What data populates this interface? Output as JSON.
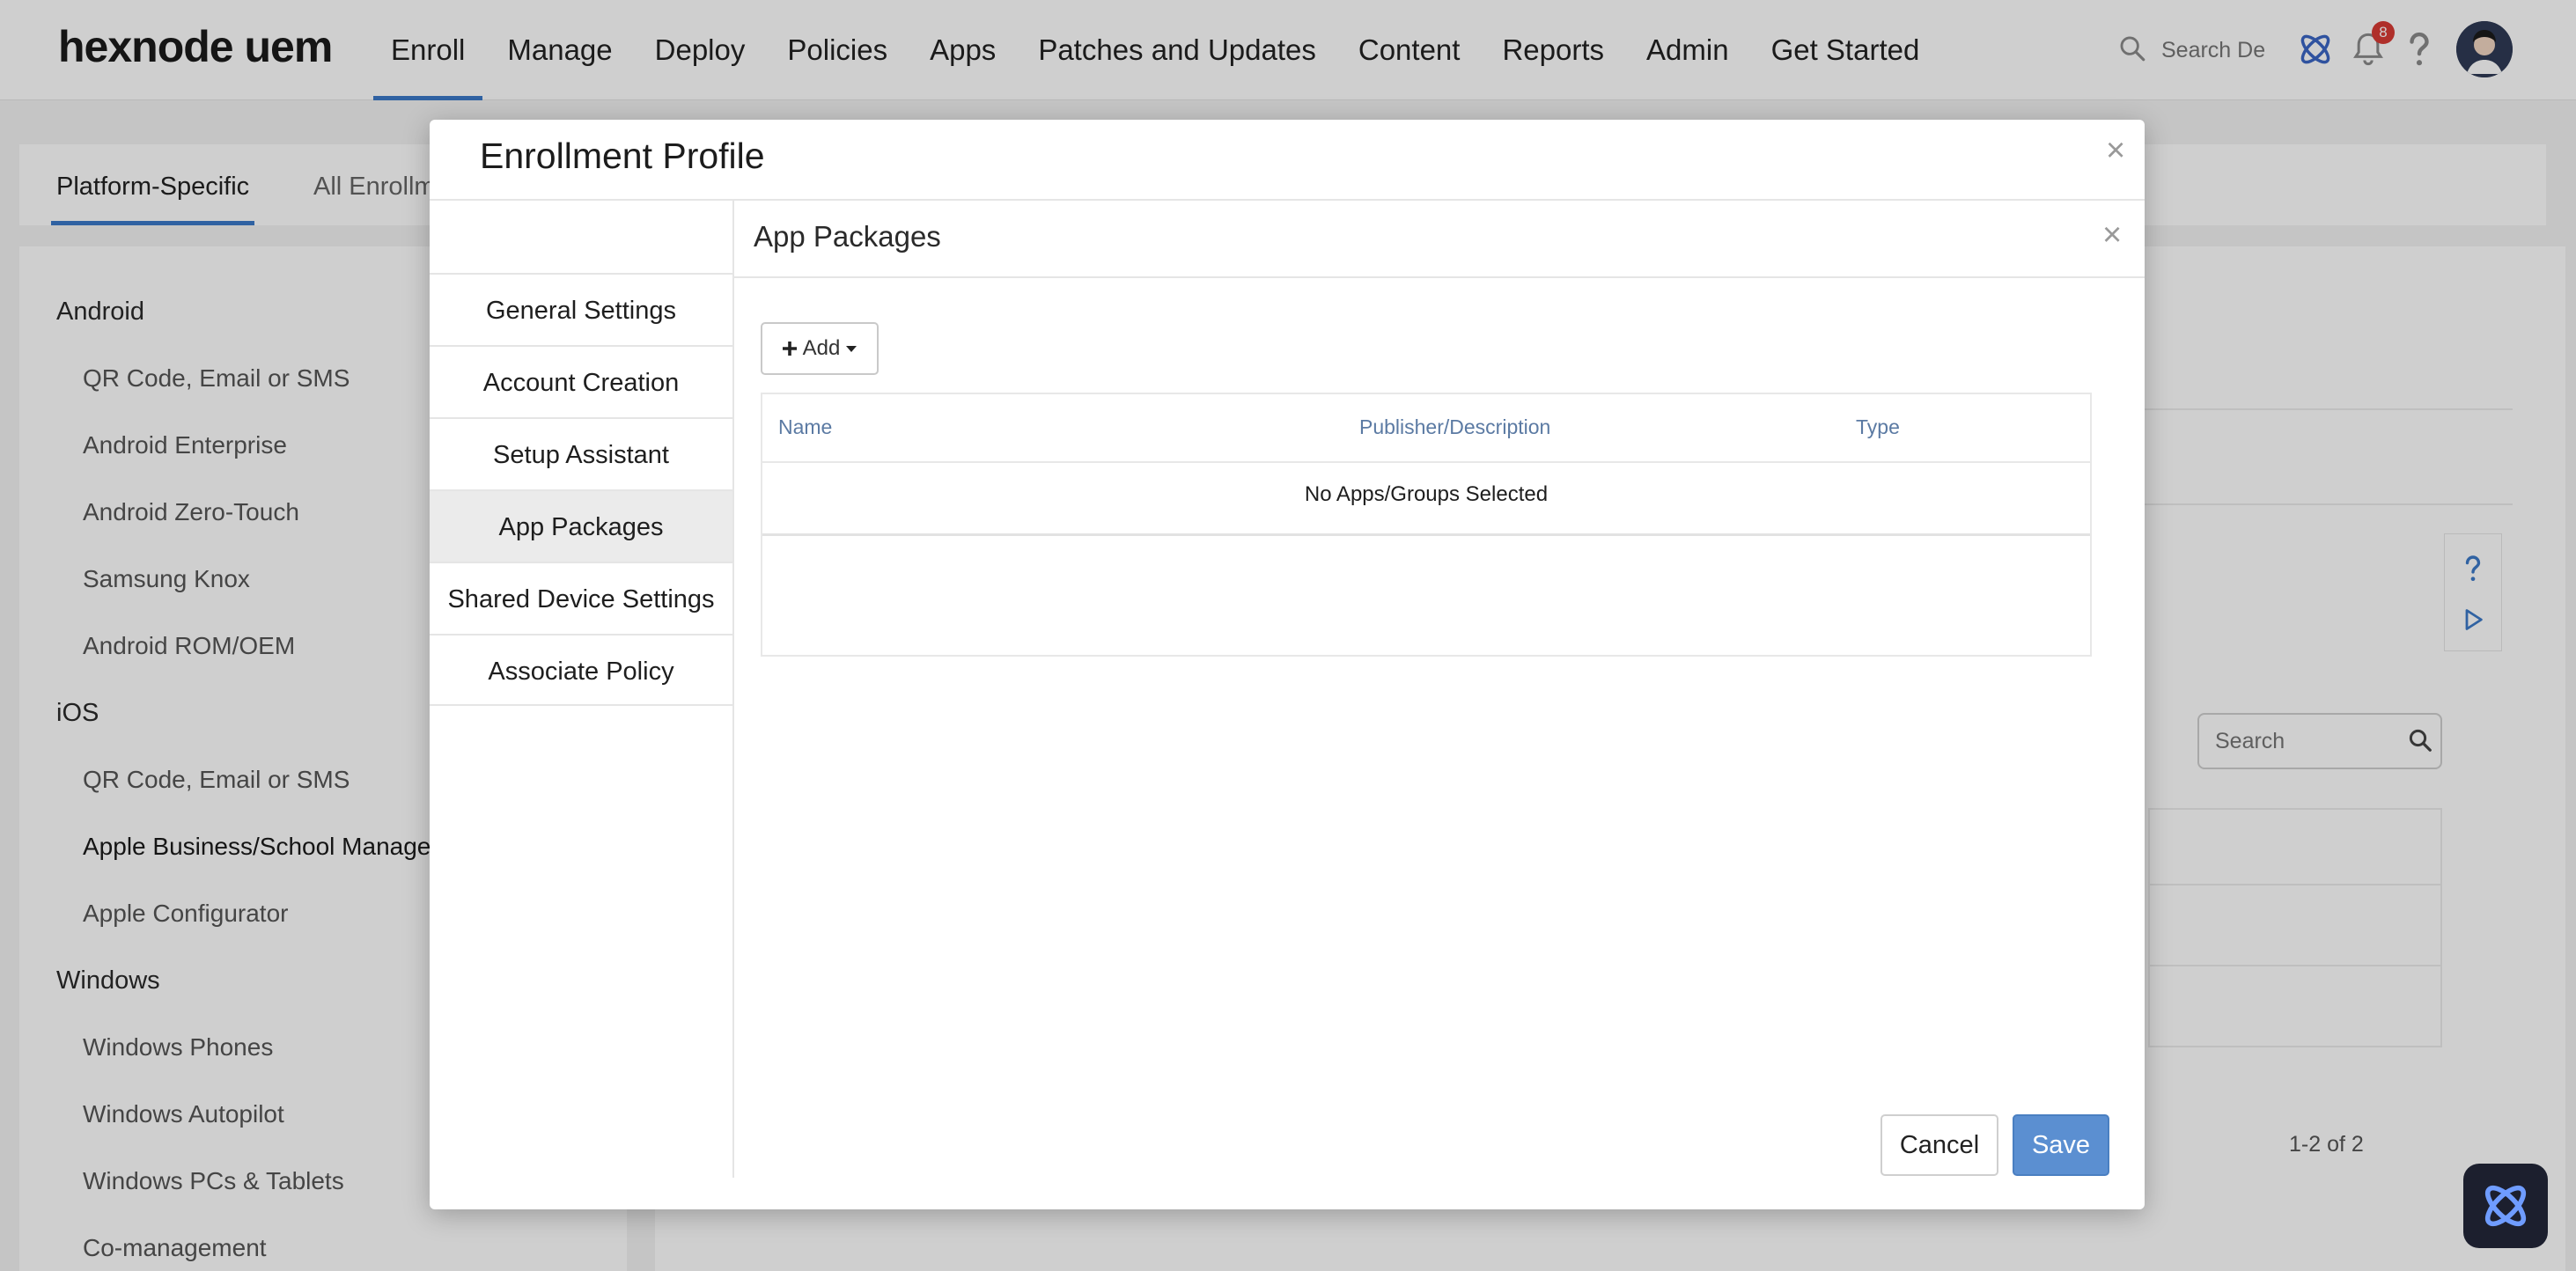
{
  "app": {
    "logo": "hexnode uem"
  },
  "nav": {
    "items": [
      "Enroll",
      "Manage",
      "Deploy",
      "Policies",
      "Apps",
      "Patches and Updates",
      "Content",
      "Reports",
      "Admin",
      "Get Started"
    ],
    "active": "Enroll"
  },
  "header": {
    "search_placeholder": "Search De",
    "notification_count": "8",
    "icons": [
      "search-icon",
      "hexnode-assist-icon",
      "bell-icon",
      "help-icon",
      "avatar"
    ]
  },
  "subtabs": {
    "platform_specific": "Platform-Specific",
    "all_enrollments": "All Enrollm"
  },
  "sidebar": {
    "android": "Android",
    "android_items": [
      "QR Code, Email or SMS",
      "Android Enterprise",
      "Android Zero-Touch",
      "Samsung Knox",
      "Android ROM/OEM"
    ],
    "ios": "iOS",
    "ios_items": [
      "QR Code, Email or SMS",
      "Apple Business/School Manager",
      "Apple Configurator"
    ],
    "windows": "Windows",
    "windows_items": [
      "Windows Phones",
      "Windows Autopilot",
      "Windows PCs & Tablets",
      "Co-management"
    ]
  },
  "background": {
    "search_placeholder": "Search",
    "pagination": "1-2 of 2"
  },
  "modal": {
    "title": "Enrollment Profile",
    "nav": [
      "General Settings",
      "Account Creation",
      "Setup Assistant",
      "App Packages",
      "Shared Device Settings",
      "Associate Policy"
    ],
    "active_nav": "App Packages",
    "section_title": "App Packages",
    "add_label": "Add",
    "table": {
      "columns": [
        "Name",
        "Publisher/Description",
        "Type"
      ],
      "empty_message": "No Apps/Groups Selected"
    },
    "cancel_label": "Cancel",
    "save_label": "Save"
  },
  "colors": {
    "accent": "#3c79c8",
    "save_button": "#5b8fd1",
    "table_header": "#5b7aa3",
    "badge": "#d83a34"
  }
}
